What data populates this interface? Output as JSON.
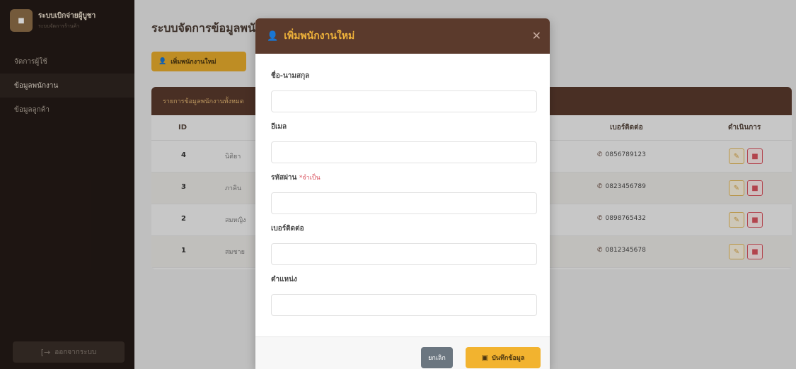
{
  "sidebar": {
    "brand_title": "ระบบเบิกจ่ายผู้บูชา",
    "brand_subtitle": "ระบบจัดการร้านค้า",
    "items": [
      {
        "label": "จัดการผู้ใช้"
      },
      {
        "label": "ข้อมูลพนักงาน"
      },
      {
        "label": "ข้อมูลลูกค้า"
      }
    ],
    "active_index": 1,
    "logout_label": "ออกจากระบบ",
    "logout_icon": "logout-icon"
  },
  "main": {
    "page_title": "ระบบจัดการข้อมูลพนักงาน",
    "add_button_label": "เพิ่มพนักงานใหม่",
    "table_title": "รายการข้อมูลพนักงานทั้งหมด",
    "columns": {
      "id": "ID",
      "phone": "เบอร์ติดต่อ",
      "action": "ดำเนินการ"
    },
    "rows": [
      {
        "id": "4",
        "name": "นิติยา",
        "phone": "0856789123"
      },
      {
        "id": "3",
        "name": "ภาคิน",
        "phone": "0823456789"
      },
      {
        "id": "2",
        "name": "สมหญิง",
        "phone": "0898765432"
      },
      {
        "id": "1",
        "name": "สมชาย",
        "phone": "0812345678"
      }
    ]
  },
  "modal": {
    "title": "เพิ่มพนักงานใหม่",
    "title_icon": "user-plus-icon",
    "close_icon": "close-icon",
    "fields": {
      "fullname": {
        "label": "ชื่อ-นามสกุล",
        "value": "",
        "placeholder": ""
      },
      "email": {
        "label": "อีเมล",
        "value": "",
        "placeholder": ""
      },
      "password": {
        "label": "รหัสผ่าน",
        "required_note": "*จำเป็น",
        "value": "",
        "placeholder": ""
      },
      "phone": {
        "label": "เบอร์ติดต่อ",
        "value": "",
        "placeholder": ""
      },
      "position": {
        "label": "ตำแหน่ง",
        "value": "",
        "placeholder": ""
      }
    },
    "cancel_label": "ยกเลิก",
    "save_label": "บันทึกข้อมูล",
    "save_icon": "save-icon"
  },
  "colors": {
    "sidebar_bg": "#241a16",
    "brand_brown": "#5b3a2c",
    "accent_gold": "#f2b32f",
    "danger": "#d9535f"
  }
}
